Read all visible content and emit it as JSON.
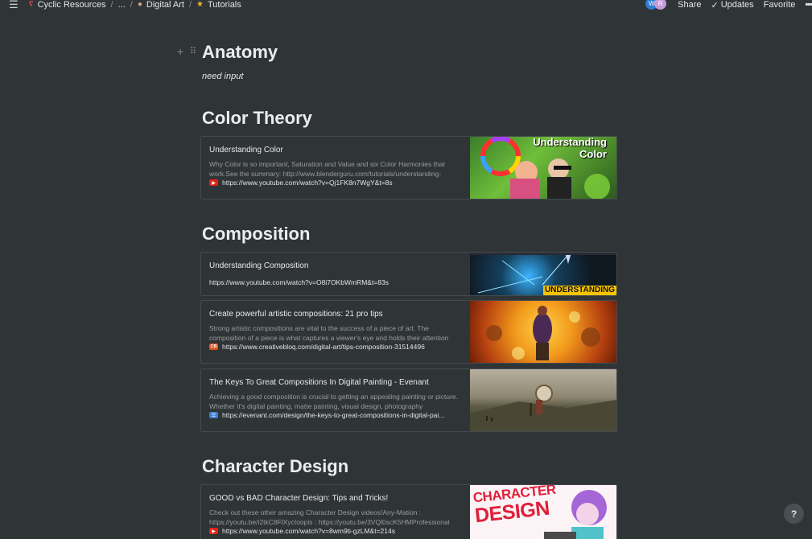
{
  "topbar": {
    "breadcrumbs": [
      "Cyclic Resources",
      "...",
      "Digital Art",
      "Tutorials"
    ],
    "avatars": [
      "W",
      "R"
    ],
    "share": "Share",
    "updates": "Updates",
    "favorite": "Favorite",
    "more": "•••"
  },
  "sections": {
    "anatomy": {
      "title": "Anatomy",
      "note": "need input"
    },
    "color_theory": {
      "title": "Color Theory"
    },
    "composition": {
      "title": "Composition"
    },
    "character_design": {
      "title": "Character Design"
    }
  },
  "cards": {
    "color1": {
      "title": "Understanding Color",
      "desc": "Why Color is so important, Saturation and Value and six Color Harmonies that work.See the summary: http://www.blenderguru.com/tutorials/understanding-",
      "url": "https://www.youtube.com/watch?v=Qj1FK8n7WgY&t=8s",
      "thumb_text": [
        "Understanding",
        "Color"
      ]
    },
    "comp1": {
      "title": "Understanding Composition",
      "url": "https://www.youtube.com/watch?v=O8i7OKbWmRM&t=83s",
      "thumb_text": "UNDERSTANDING"
    },
    "comp2": {
      "title": "Create powerful artistic compositions: 21 pro tips",
      "desc": "Strong artistic compositions are vital to the success of a piece of art. The composition of a piece is what captures a viewer's eye and holds their attention",
      "url": "https://www.creativebloq.com/digital-art/tips-composition-31514496",
      "fav": "CB"
    },
    "comp3": {
      "title": "The Keys To Great Compositions In Digital Painting - Evenant",
      "desc": "Achieving a good composition is crucial to getting an appealing painting or picture. Whether it's digital painting, matte painting, visual design, photography",
      "url": "https://evenant.com/design/the-keys-to-great-compositions-in-digital-pai..."
    },
    "char1": {
      "title": "GOOD vs BAD Character Design: Tips and Tricks!",
      "desc": "Check out these other amazing Character Design videos!Any-Mation : https://youtu.be/i2tkC8FlXycIoopis : https://youtu.be/3VQl0scK5HMProfessional",
      "url": "https://www.youtube.com/watch?v=8wm9ti-gzLM&t=214s",
      "thumb_text": [
        "CHARACTER",
        "DESIGN"
      ]
    }
  },
  "help": "?",
  "colors": {
    "background": "#2f3437",
    "card_border": "#454a4e",
    "youtube_red": "#e62117",
    "star": "#f0b72f"
  }
}
